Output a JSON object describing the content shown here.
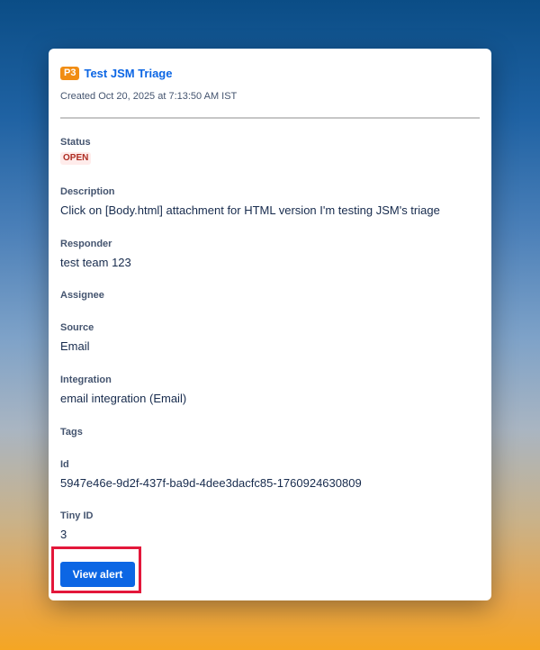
{
  "alert": {
    "priority": "P3",
    "title": "Test JSM Triage",
    "created": "Created Oct 20, 2025 at 7:13:50 AM IST"
  },
  "fields": {
    "status": {
      "label": "Status",
      "value": "OPEN"
    },
    "description": {
      "label": "Description",
      "value": "Click on [Body.html] attachment for HTML version I'm testing JSM's triage"
    },
    "responder": {
      "label": "Responder",
      "value": "test team 123"
    },
    "assignee": {
      "label": "Assignee",
      "value": ""
    },
    "source": {
      "label": "Source",
      "value": "Email"
    },
    "integration": {
      "label": "Integration",
      "value": "email integration (Email)"
    },
    "tags": {
      "label": "Tags",
      "value": ""
    },
    "id": {
      "label": "Id",
      "value": "5947e46e-9d2f-437f-ba9d-4dee3dacfc85-1760924630809"
    },
    "tiny_id": {
      "label": "Tiny ID",
      "value": "3"
    }
  },
  "actions": {
    "view_alert_label": "View alert"
  },
  "colors": {
    "priority_bg": "#f18d13",
    "link": "#0c66e4",
    "status_bg": "#ffeceb",
    "status_text": "#ae2e24",
    "button_bg": "#0c66e4",
    "highlight_border": "#e3173a"
  }
}
